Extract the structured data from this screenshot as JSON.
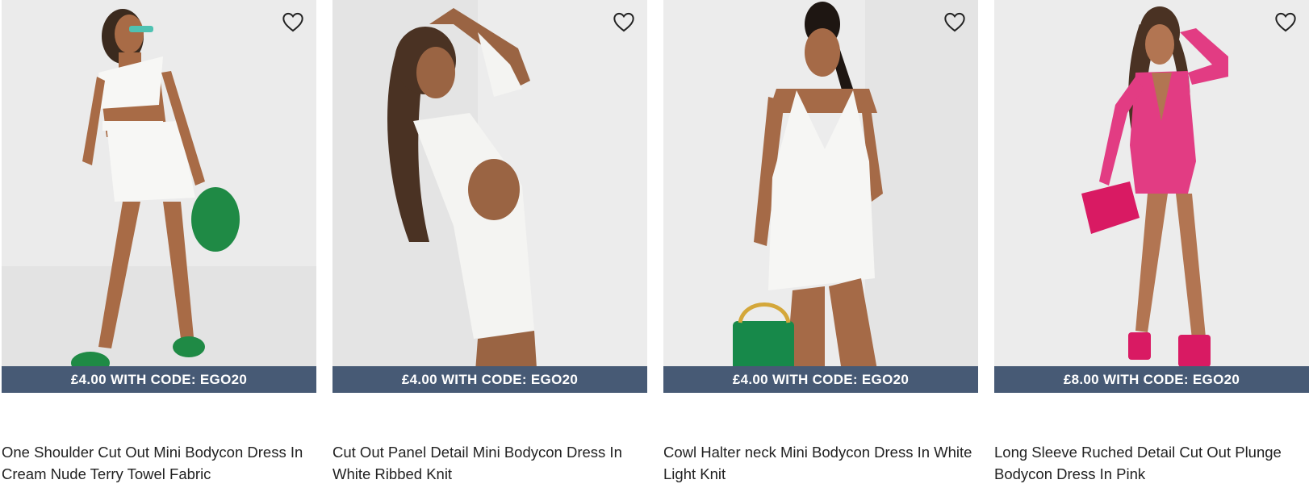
{
  "colors": {
    "promo_bg": "#475a75",
    "promo_text": "#ffffff",
    "title_text": "#222222",
    "photo_bg": "#e9e9e9"
  },
  "products": [
    {
      "title": "One Shoulder Cut Out Mini Bodycon Dress In Cream Nude Terry Towel Fabric",
      "promo": "£4.00 WITH CODE: EGO20",
      "wishlist_icon": "heart-outline-icon",
      "dress_color": "#f7f7f5",
      "accessory_color": "#1f8a45"
    },
    {
      "title": "Cut Out Panel Detail Mini Bodycon Dress In White Ribbed Knit",
      "promo": "£4.00 WITH CODE: EGO20",
      "wishlist_icon": "heart-outline-icon",
      "dress_color": "#f4f4f2",
      "accessory_color": ""
    },
    {
      "title": "Cowl Halter neck Mini Bodycon Dress In White Light Knit",
      "promo": "£4.00 WITH CODE: EGO20",
      "wishlist_icon": "heart-outline-icon",
      "dress_color": "#f6f6f4",
      "accessory_color": "#17894a"
    },
    {
      "title": "Long Sleeve Ruched Detail Cut Out Plunge Bodycon Dress In Pink",
      "promo": "£8.00 WITH CODE: EGO20",
      "wishlist_icon": "heart-outline-icon",
      "dress_color": "#e23c83",
      "accessory_color": "#d91a63"
    }
  ]
}
